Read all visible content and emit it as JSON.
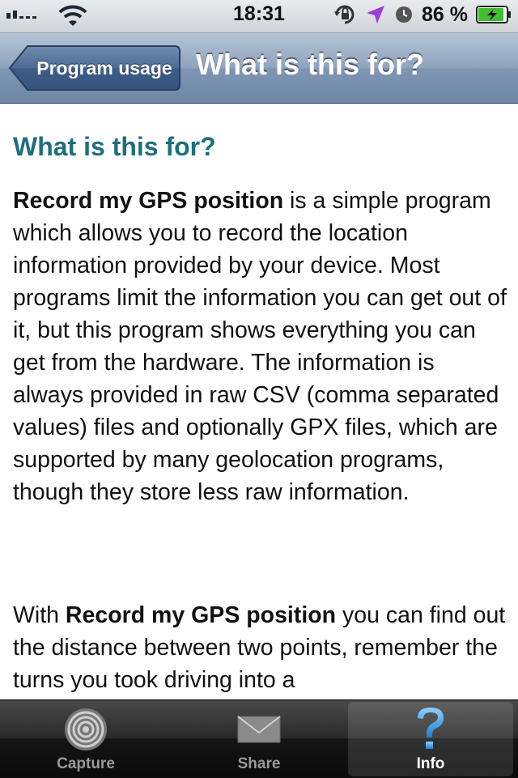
{
  "status_bar": {
    "time": "18:31",
    "battery_percent": "86 %",
    "signal_bars": 2,
    "icons": [
      "signal-icon",
      "wifi-icon",
      "rotation-lock-icon",
      "location-icon",
      "alarm-icon",
      "battery-icon"
    ]
  },
  "nav": {
    "back_label": "Program usage",
    "title": "What is this for?"
  },
  "content": {
    "heading": "What is this for?",
    "p1_bold": "Record my GPS position",
    "p1_rest": " is a simple program which allows you to record the location information provided by your device. Most programs limit the information you can get out of it, but this program shows everything you can get from the hardware. The information is always provided in raw CSV (comma separated values) files and optionally GPX files, which are supported by many geolocation programs, though they store less raw information.",
    "p2_start": "With ",
    "p2_bold": "Record my GPS position",
    "p2_rest": " you can find out the distance between two points, remember the turns you took driving into a"
  },
  "tabs": [
    {
      "label": "Capture",
      "icon": "capture-icon"
    },
    {
      "label": "Share",
      "icon": "envelope-icon"
    },
    {
      "label": "Info",
      "icon": "question-icon",
      "active": true
    }
  ],
  "colors": {
    "heading": "#1d6f7e",
    "nav_bar": "#7f96b3",
    "tab_active": "#ffffff"
  }
}
